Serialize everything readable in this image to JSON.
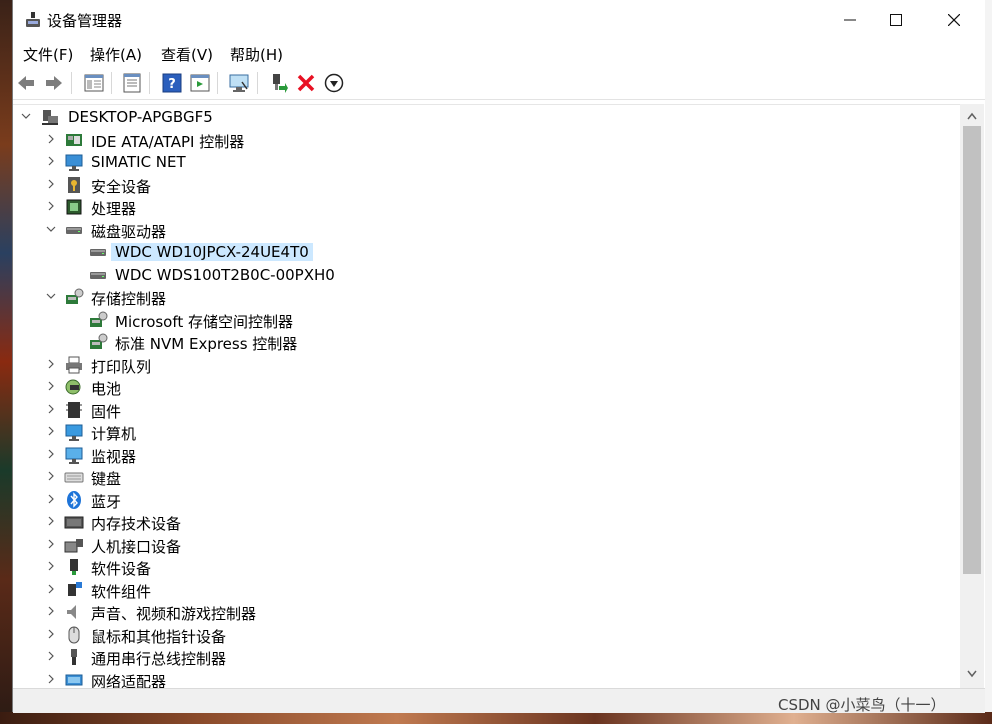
{
  "window": {
    "title": "设备管理器",
    "controls": [
      "minimize",
      "maximize",
      "close"
    ]
  },
  "menu": [
    {
      "label": "文件(F)"
    },
    {
      "label": "操作(A)"
    },
    {
      "label": "查看(V)"
    },
    {
      "label": "帮助(H)"
    }
  ],
  "toolbar": {
    "buttons": [
      "back-icon",
      "forward-icon",
      "show-hide-tree-icon",
      "properties-icon",
      "help-icon",
      "action-pane-icon",
      "scan-hardware-icon",
      "update-driver-icon",
      "uninstall-icon",
      "disable-icon"
    ]
  },
  "tree": {
    "root": "DESKTOP-APGBGF5",
    "items": [
      {
        "label": "IDE ATA/ATAPI 控制器",
        "expanded": false,
        "icon": "ide-controller-icon"
      },
      {
        "label": "SIMATIC NET",
        "expanded": false,
        "icon": "network-monitor-icon"
      },
      {
        "label": "安全设备",
        "expanded": false,
        "icon": "security-device-icon"
      },
      {
        "label": "处理器",
        "expanded": false,
        "icon": "processor-icon"
      },
      {
        "label": "磁盘驱动器",
        "expanded": true,
        "icon": "disk-drive-icon",
        "children": [
          {
            "label": "WDC WD10JPCX-24UE4T0",
            "selected": true,
            "icon": "disk-drive-icon"
          },
          {
            "label": "WDC WDS100T2B0C-00PXH0",
            "selected": false,
            "icon": "disk-drive-icon"
          }
        ]
      },
      {
        "label": "存储控制器",
        "expanded": true,
        "icon": "storage-controller-icon",
        "children": [
          {
            "label": "Microsoft 存储空间控制器",
            "selected": false,
            "icon": "storage-controller-icon"
          },
          {
            "label": "标准 NVM Express 控制器",
            "selected": false,
            "icon": "storage-controller-icon"
          }
        ]
      },
      {
        "label": "打印队列",
        "expanded": false,
        "icon": "printer-icon"
      },
      {
        "label": "电池",
        "expanded": false,
        "icon": "battery-icon"
      },
      {
        "label": "固件",
        "expanded": false,
        "icon": "firmware-icon"
      },
      {
        "label": "计算机",
        "expanded": false,
        "icon": "computer-icon"
      },
      {
        "label": "监视器",
        "expanded": false,
        "icon": "monitor-icon"
      },
      {
        "label": "键盘",
        "expanded": false,
        "icon": "keyboard-icon"
      },
      {
        "label": "蓝牙",
        "expanded": false,
        "icon": "bluetooth-icon"
      },
      {
        "label": "内存技术设备",
        "expanded": false,
        "icon": "memory-device-icon"
      },
      {
        "label": "人机接口设备",
        "expanded": false,
        "icon": "hid-icon"
      },
      {
        "label": "软件设备",
        "expanded": false,
        "icon": "software-device-icon"
      },
      {
        "label": "软件组件",
        "expanded": false,
        "icon": "software-component-icon"
      },
      {
        "label": "声音、视频和游戏控制器",
        "expanded": false,
        "icon": "audio-icon"
      },
      {
        "label": "鼠标和其他指针设备",
        "expanded": false,
        "icon": "mouse-icon"
      },
      {
        "label": "通用串行总线控制器",
        "expanded": false,
        "icon": "usb-icon"
      },
      {
        "label": "网络适配器",
        "expanded": false,
        "icon": "network-adapter-icon"
      }
    ]
  },
  "watermark": "CSDN @小菜鸟（十一）",
  "colors": {
    "selection": "#cce8ff",
    "uninstall_red": "#e81123"
  }
}
